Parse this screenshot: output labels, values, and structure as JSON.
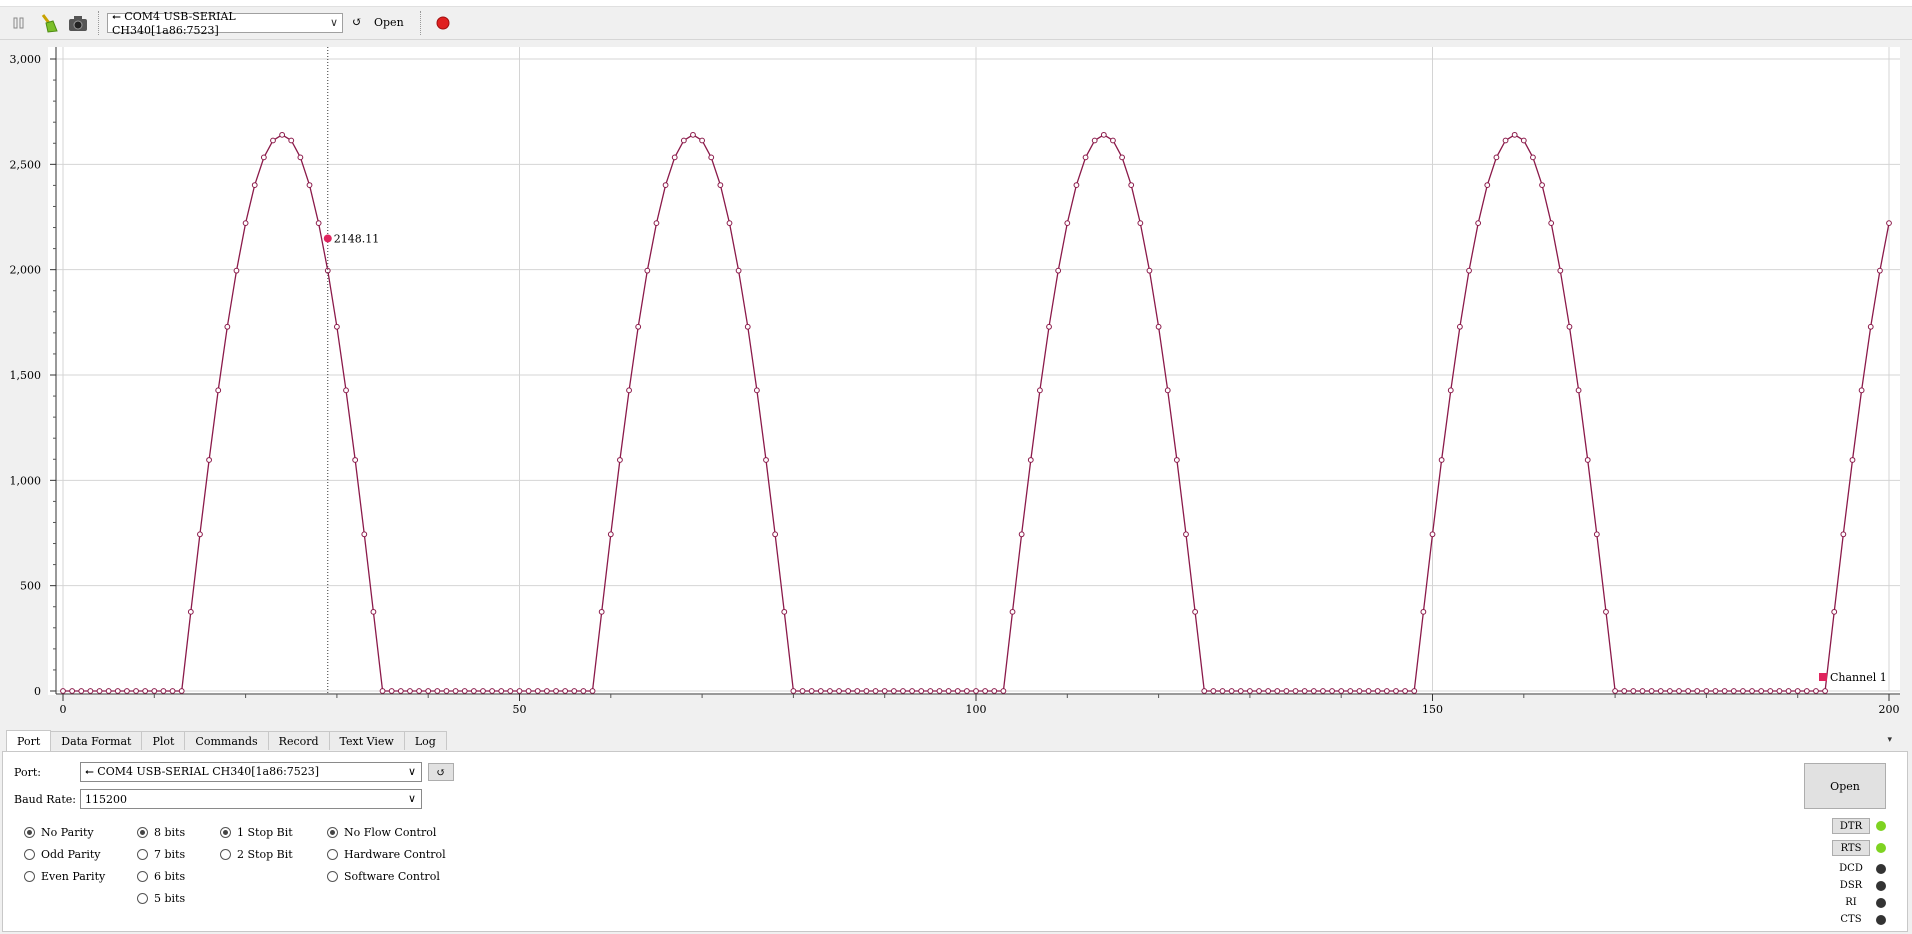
{
  "toolbar": {
    "port_value": "⭠ COM4 USB-SERIAL CH340[1a86:7523]",
    "refresh_glyph": "↺",
    "open_label": "Open",
    "icons": [
      "pause-icon",
      "broom-icon",
      "camera-icon",
      "record-icon"
    ]
  },
  "chart_data": {
    "type": "line",
    "series": [
      {
        "name": "Channel 1",
        "color": "#8b1a4a"
      }
    ],
    "x_ticks": [
      "0",
      "50",
      "100",
      "150",
      "200"
    ],
    "y_ticks": [
      "0",
      "500",
      "1,000",
      "1,500",
      "2,000",
      "2,500",
      "3,000"
    ],
    "xlim": [
      0,
      200
    ],
    "ylim": [
      0,
      3000
    ],
    "grid": true,
    "legend_placement": "bottom-right",
    "peak_value": 2640,
    "period_samples": 45,
    "pulse_width_samples": 22,
    "cursor": {
      "x": 29,
      "value": "2148.11"
    }
  },
  "tabs": [
    "Port",
    "Data Format",
    "Plot",
    "Commands",
    "Record",
    "Text View",
    "Log"
  ],
  "tabs_menu_glyph": "▾",
  "port_panel": {
    "port_label": "Port:",
    "port_value": "⭠ COM4 USB-SERIAL CH340[1a86:7523]",
    "refresh_glyph": "↺",
    "baud_label": "Baud Rate:",
    "baud_value": "115200",
    "dropdown_glyph": "∨",
    "parity": [
      "No Parity",
      "Odd Parity",
      "Even Parity"
    ],
    "data_bits": [
      "8 bits",
      "7 bits",
      "6 bits",
      "5 bits"
    ],
    "stop_bits": [
      "1 Stop Bit",
      "2 Stop Bit"
    ],
    "flow_control": [
      "No Flow Control",
      "Hardware Control",
      "Software Control"
    ],
    "open_label": "Open",
    "signals": {
      "dtr": "DTR",
      "rts": "RTS",
      "dcd": "DCD",
      "dsr": "DSR",
      "ri": "RI",
      "cts": "CTS"
    }
  },
  "colors": {
    "series": "#8b1a4a",
    "marker_fill": "#ffffff",
    "cursor_point": "#e0245e",
    "led_on": "#7ed321",
    "led_off": "#333333"
  }
}
